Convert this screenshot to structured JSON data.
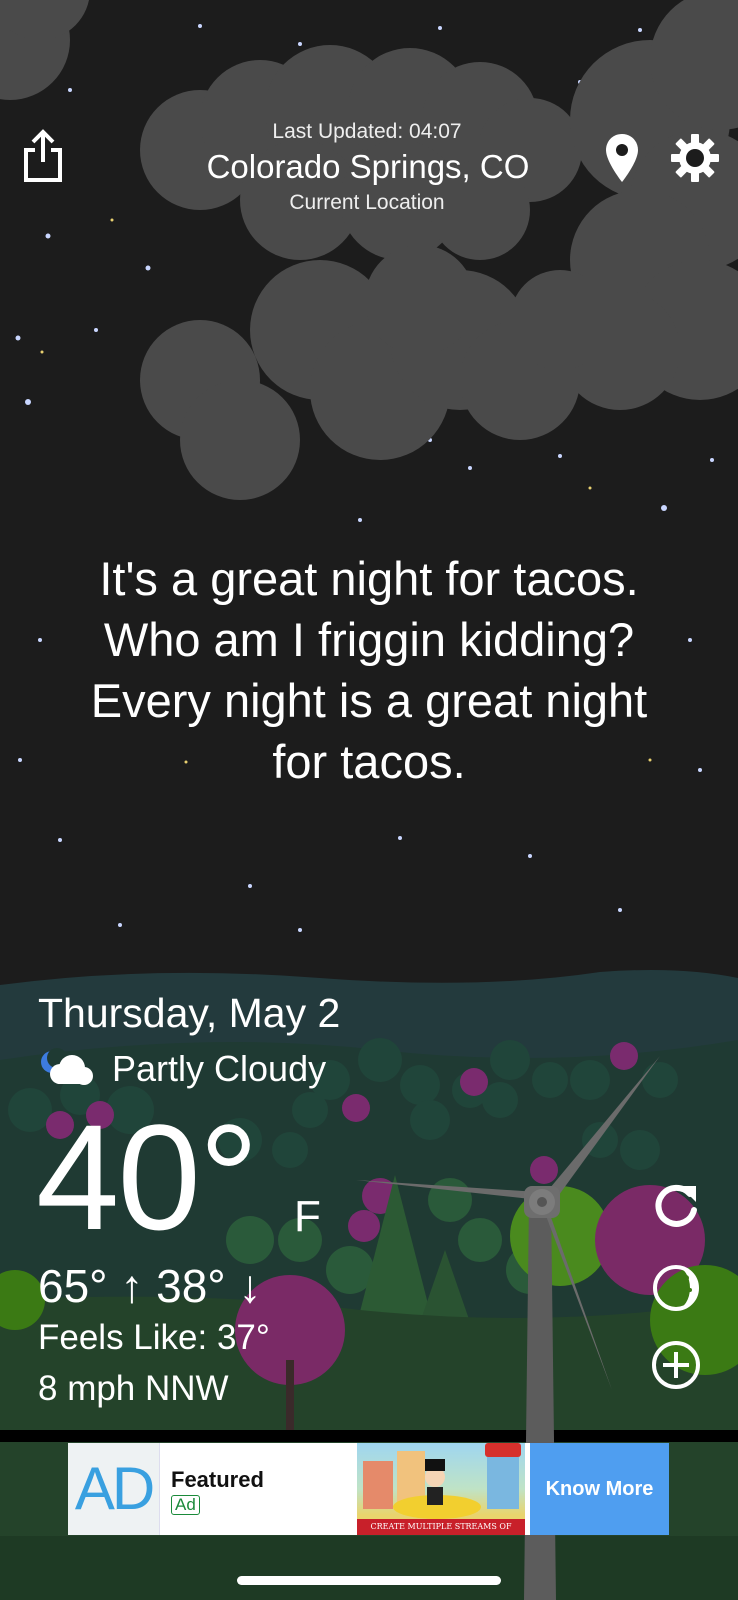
{
  "header": {
    "last_updated": "Last Updated: 04:07",
    "location": "Colorado Springs, CO",
    "location_sub": "Current Location"
  },
  "icons": {
    "share": "share-icon",
    "pin": "map-pin-icon",
    "settings": "gear-icon",
    "refresh": "refresh-icon",
    "moon": "moon-phase-icon",
    "add": "add-circle-icon",
    "condition": "partly-cloudy-night-icon"
  },
  "message": [
    "It's a great night for tacos.",
    "Who am I friggin kidding?",
    "Every night is a great night",
    "for tacos."
  ],
  "weather": {
    "date": "Thursday, May 2",
    "condition": "Partly Cloudy",
    "temp": "40°",
    "unit": "F",
    "hilo": "65° ↑ 38° ↓",
    "feels_like": "Feels Like: 37°",
    "wind": "8 mph NNW"
  },
  "ad": {
    "logo": "AD",
    "featured": "Featured",
    "tag": "Ad",
    "banner": "CREATE MULTIPLE STREAMS OF INCOME",
    "cta": "Know More"
  },
  "colors": {
    "sky": "#1c1c1c",
    "cloud": "#4a4a4a",
    "hills": "#233a3d",
    "grass": "#24432a",
    "ad_cta": "#4f9ef0"
  }
}
